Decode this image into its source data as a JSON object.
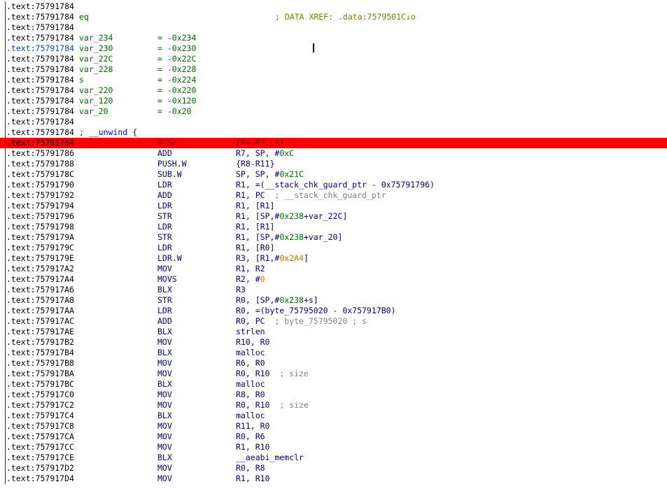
{
  "header_lines": [
    {
      "addr": ".text:75791784",
      "kind": "blank"
    },
    {
      "addr": ".text:75791784",
      "kind": "xref",
      "name": "eq",
      "comment": "; DATA XREF: .data:7579501C↓o"
    },
    {
      "addr": ".text:75791784",
      "kind": "blank"
    },
    {
      "addr": ".text:75791784",
      "kind": "var",
      "name": "var_234",
      "value": "= -0x234",
      "selected": false
    },
    {
      "addr": ".text:75791784",
      "kind": "var",
      "name": "var_230",
      "value": "= -0x230",
      "selected": true
    },
    {
      "addr": ".text:75791784",
      "kind": "var",
      "name": "var_22C",
      "value": "= -0x22C",
      "selected": false
    },
    {
      "addr": ".text:75791784",
      "kind": "var",
      "name": "var_228",
      "value": "= -0x228",
      "selected": false
    },
    {
      "addr": ".text:75791784",
      "kind": "var",
      "name": "s",
      "value": "= -0x224",
      "selected": false
    },
    {
      "addr": ".text:75791784",
      "kind": "var",
      "name": "var_220",
      "value": "= -0x220",
      "selected": false
    },
    {
      "addr": ".text:75791784",
      "kind": "var",
      "name": "var_120",
      "value": "= -0x120",
      "selected": false
    },
    {
      "addr": ".text:75791784",
      "kind": "var",
      "name": "var_20",
      "value": "= -0x20",
      "selected": false
    },
    {
      "addr": ".text:75791784",
      "kind": "blank"
    },
    {
      "addr": ".text:75791784",
      "kind": "unwind",
      "text": "; __unwind {"
    }
  ],
  "instructions": [
    {
      "addr": ".text:75791784",
      "mnem": "PUSH",
      "ops": "{R4-R7,LR}",
      "highlight": true
    },
    {
      "addr": ".text:75791786",
      "mnem": "ADD",
      "ops": "R7, SP, #0xC"
    },
    {
      "addr": ".text:75791788",
      "mnem": "PUSH.W",
      "ops": "{R8-R11}"
    },
    {
      "addr": ".text:7579178C",
      "mnem": "SUB.W",
      "ops": "SP, SP, #0x21C"
    },
    {
      "addr": ".text:75791790",
      "mnem": "LDR",
      "ops": "R1, =(__stack_chk_guard_ptr - 0x75791796)"
    },
    {
      "addr": ".text:75791792",
      "mnem": "ADD",
      "ops": "R1, PC",
      "comment": "; __stack_chk_guard_ptr"
    },
    {
      "addr": ".text:75791794",
      "mnem": "LDR",
      "ops": "R1, [R1]"
    },
    {
      "addr": ".text:75791796",
      "mnem": "STR",
      "ops": "R1, [SP,#0x238+var_22C]"
    },
    {
      "addr": ".text:75791798",
      "mnem": "LDR",
      "ops": "R1, [R1]"
    },
    {
      "addr": ".text:7579179A",
      "mnem": "STR",
      "ops": "R1, [SP,#0x238+var_20]"
    },
    {
      "addr": ".text:7579179C",
      "mnem": "LDR",
      "ops": "R1, [R0]"
    },
    {
      "addr": ".text:7579179E",
      "mnem": "LDR.W",
      "ops": "R3, [R1,#0x2A4]"
    },
    {
      "addr": ".text:757917A2",
      "mnem": "MOV",
      "ops": "R1, R2"
    },
    {
      "addr": ".text:757917A4",
      "mnem": "MOVS",
      "ops": "R2, #0"
    },
    {
      "addr": ".text:757917A6",
      "mnem": "BLX",
      "ops": "R3"
    },
    {
      "addr": ".text:757917A8",
      "mnem": "STR",
      "ops": "R0, [SP,#0x238+s]"
    },
    {
      "addr": ".text:757917AA",
      "mnem": "LDR",
      "ops": "R0, =(byte_75795020 - 0x757917B0)"
    },
    {
      "addr": ".text:757917AC",
      "mnem": "ADD",
      "ops": "R0, PC",
      "comment": "; byte_75795020 ; s"
    },
    {
      "addr": ".text:757917AE",
      "mnem": "BLX",
      "ops": "strlen"
    },
    {
      "addr": ".text:757917B2",
      "mnem": "MOV",
      "ops": "R10, R0"
    },
    {
      "addr": ".text:757917B4",
      "mnem": "BLX",
      "ops": "malloc"
    },
    {
      "addr": ".text:757917B8",
      "mnem": "MOV",
      "ops": "R6, R0"
    },
    {
      "addr": ".text:757917BA",
      "mnem": "MOV",
      "ops": "R0, R10",
      "comment": "; size"
    },
    {
      "addr": ".text:757917BC",
      "mnem": "BLX",
      "ops": "malloc"
    },
    {
      "addr": ".text:757917C0",
      "mnem": "MOV",
      "ops": "R8, R0"
    },
    {
      "addr": ".text:757917C2",
      "mnem": "MOV",
      "ops": "R0, R10",
      "comment": "; size"
    },
    {
      "addr": ".text:757917C4",
      "mnem": "BLX",
      "ops": "malloc"
    },
    {
      "addr": ".text:757917C8",
      "mnem": "MOV",
      "ops": "R11, R0"
    },
    {
      "addr": ".text:757917CA",
      "mnem": "MOV",
      "ops": "R0, R6"
    },
    {
      "addr": ".text:757917CC",
      "mnem": "MOV",
      "ops": "R1, R10"
    },
    {
      "addr": ".text:757917CE",
      "mnem": "BLX",
      "ops": "__aeabi_memclr"
    },
    {
      "addr": ".text:757917D2",
      "mnem": "MOV",
      "ops": "R0, R8"
    },
    {
      "addr": ".text:757917D4",
      "mnem": "MOV",
      "ops": "R1, R10"
    }
  ],
  "colors": {
    "highlight": "#ff0000",
    "name": "#006a00",
    "mnemonic": "#000080",
    "comment": "#808080",
    "immediate": "#e07000",
    "xref": "#7a7a00"
  }
}
